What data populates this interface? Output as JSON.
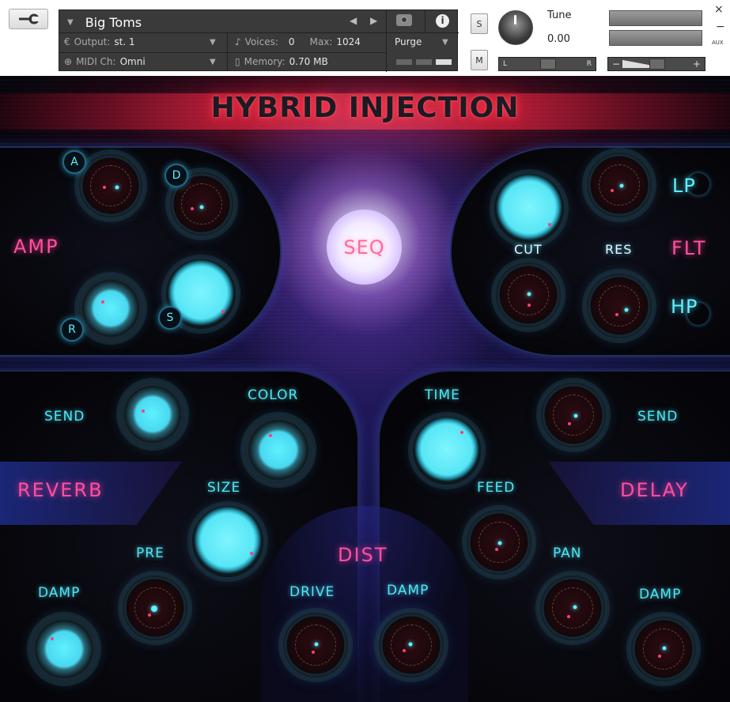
{
  "header": {
    "instrument_name": "Big Toms",
    "output_label": "Output:",
    "output_value": "st. 1",
    "voices_label": "Voices:",
    "voices_value": "0",
    "max_label": "Max:",
    "max_value": "1024",
    "purge_label": "Purge",
    "midi_label": "MIDI Ch:",
    "midi_value": "Omni",
    "memory_label": "Memory:",
    "memory_value": "0.70 MB",
    "solo_label": "S",
    "mute_label": "M",
    "tune_label": "Tune",
    "tune_value": "0.00",
    "pan_left": "L",
    "pan_right": "R",
    "vol_minus": "−",
    "vol_plus": "+",
    "aux_label": "AUX",
    "close_symbol": "×",
    "minimize_symbol": "−"
  },
  "instrument": {
    "title": "HYBRID INJECTION",
    "seq_label": "SEQ",
    "amp": {
      "title": "AMP",
      "a": "A",
      "d": "D",
      "s": "S",
      "r": "R"
    },
    "filter": {
      "title": "FLT",
      "cut": "CUT",
      "res": "RES",
      "lp": "LP",
      "hp": "HP"
    },
    "reverb": {
      "title": "REVERB",
      "send": "SEND",
      "color": "COLOR",
      "size": "SIZE",
      "pre": "PRE",
      "damp": "DAMP"
    },
    "dist": {
      "title": "DIST",
      "drive": "DRIVE",
      "damp": "DAMP"
    },
    "delay": {
      "title": "DELAY",
      "time": "TIME",
      "send": "SEND",
      "feed": "FEED",
      "pan": "PAN",
      "damp": "DAMP"
    }
  },
  "colors": {
    "cyan_accent": "#5ef0ff",
    "pink_accent": "#ff4fa0",
    "title_glow": "#ff3c50"
  }
}
